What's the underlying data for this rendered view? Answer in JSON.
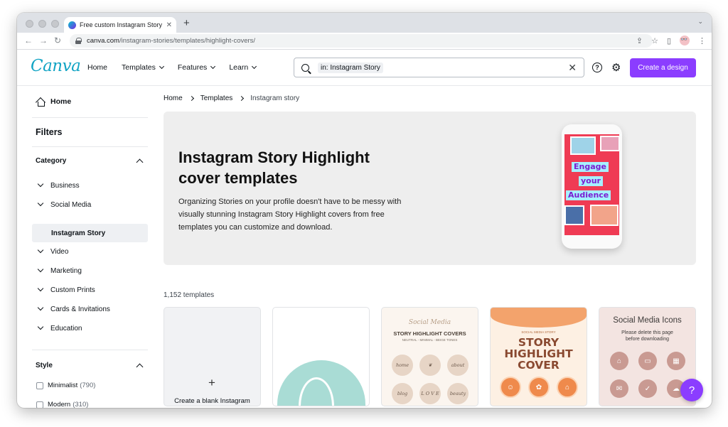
{
  "browser": {
    "tab_title": "Free custom Instagram Story H",
    "new_tab": "+",
    "url_host": "canva.com",
    "url_path": "/instagram-stories/templates/highlight-covers/"
  },
  "header": {
    "logo": "Canva",
    "nav": [
      "Home",
      "Templates",
      "Features",
      "Learn"
    ],
    "search_chip": "in: Instagram Story",
    "help_icon": "?",
    "cta": "Create a design"
  },
  "sidebar": {
    "home": "Home",
    "filters": "Filters",
    "category_title": "Category",
    "categories": [
      "Business",
      "Social Media",
      "Instagram Story",
      "Video",
      "Marketing",
      "Custom Prints",
      "Cards & Invitations",
      "Education"
    ],
    "style_title": "Style",
    "styles": [
      {
        "label": "Minimalist",
        "count": "(790)"
      },
      {
        "label": "Modern",
        "count": "(310)"
      }
    ]
  },
  "breadcrumb": [
    "Home",
    "Templates",
    "Instagram story"
  ],
  "hero": {
    "title": "Instagram Story Highlight cover templates",
    "description": "Organizing Stories on your profile doesn't have to be messy with visually stunning Instagram Story Highlight covers from free templates you can customize and download.",
    "phone_words": [
      "Engage",
      "your",
      "Audience"
    ]
  },
  "templates_count": "1,152 templates",
  "cards": {
    "blank_plus": "+",
    "blank_label": "Create a blank Instagram",
    "beige": {
      "script": "Social Media",
      "title": "STORY HIGHLIGHT COVERS",
      "sub": "NEUTRAL - MINIMAL - BEIGE TONES",
      "circles": [
        "home",
        "",
        "about",
        "blog",
        "L O V E",
        "beauty"
      ]
    },
    "orange": {
      "kicker": "SOCIAL MEDIA STORY",
      "big": [
        "STORY",
        "HIGHLIGHT",
        "COVER"
      ]
    },
    "pink": {
      "title": "Social Media Icons",
      "note": "Please delete this page before downloading"
    }
  },
  "help_fab": "?"
}
